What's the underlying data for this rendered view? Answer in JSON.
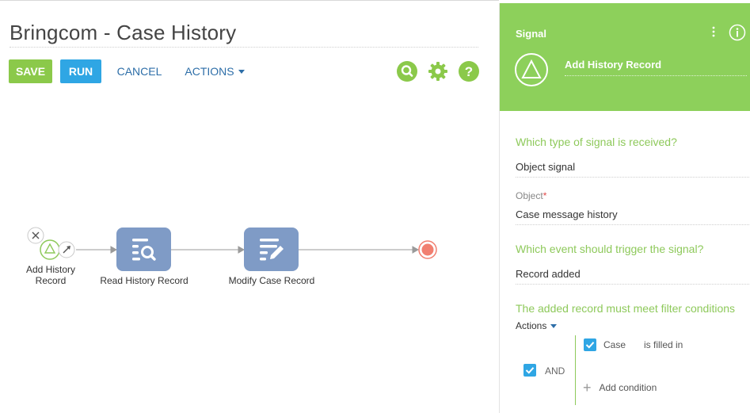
{
  "page": {
    "title": "Bringcom - Case History"
  },
  "toolbar": {
    "save_label": "SAVE",
    "run_label": "RUN",
    "cancel_label": "CANCEL",
    "actions_label": "ACTIONS",
    "icons": [
      "search-icon",
      "gear-icon",
      "help-icon"
    ]
  },
  "flow": {
    "start_label": "Add History Record",
    "start_label_line1": "Add History",
    "start_label_line2": "Record",
    "tasks": [
      {
        "label": "Read History Record",
        "icon": "read-data-icon"
      },
      {
        "label": "Modify Case Record",
        "icon": "modify-data-icon"
      }
    ],
    "end_icon": "end-event-icon"
  },
  "panel": {
    "header": {
      "type_label": "Signal",
      "element_name": "Add History Record"
    },
    "signal_type_question": "Which type of signal is received?",
    "signal_type_value": "Object signal",
    "object_caption": "Object",
    "object_required_mark": "*",
    "object_value": "Case message history",
    "event_question": "Which event should trigger the signal?",
    "event_value": "Record added",
    "filter_question": "The added record must meet filter conditions",
    "actions_label": "Actions",
    "filter": {
      "group_operator": "AND",
      "conditions": [
        {
          "field": "Case",
          "operator": "is filled in"
        }
      ],
      "add_condition_label": "Add condition"
    }
  },
  "colors": {
    "accent_green": "#8dd05b",
    "save_green": "#8bc94a",
    "run_blue": "#2fa6e4",
    "task_blue": "#7f9bc6",
    "end_red": "#f17f70"
  }
}
